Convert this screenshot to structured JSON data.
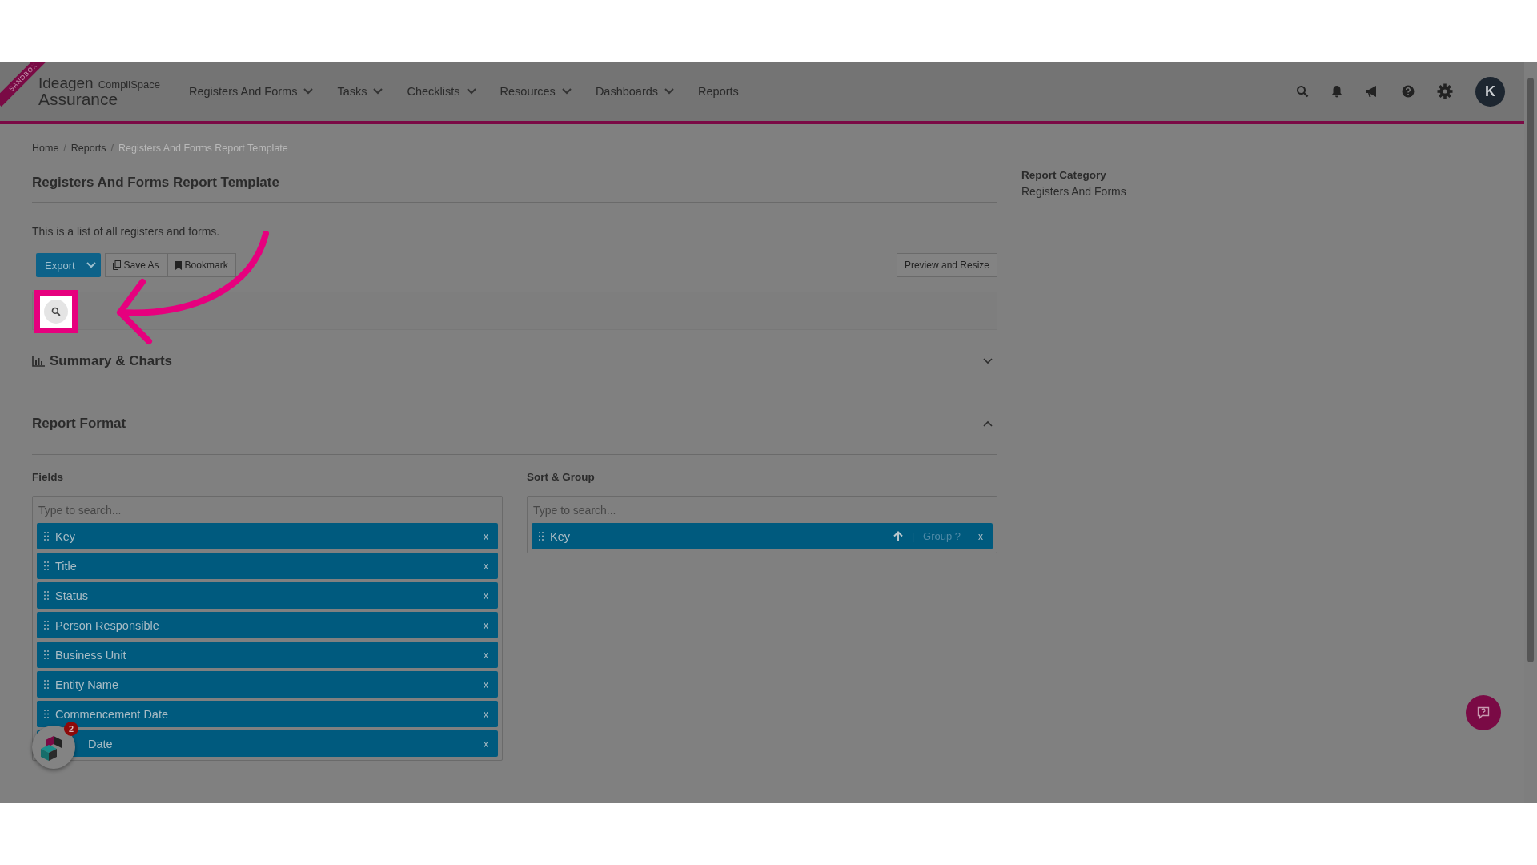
{
  "header": {
    "ribbon": "SANDBOX",
    "logo": {
      "brand": "Ideagen",
      "product": "CompliSpace",
      "subtitle": "Assurance"
    },
    "nav": [
      {
        "label": "Registers And Forms",
        "dropdown": true
      },
      {
        "label": "Tasks",
        "dropdown": true
      },
      {
        "label": "Checklists",
        "dropdown": true
      },
      {
        "label": "Resources",
        "dropdown": true
      },
      {
        "label": "Dashboards",
        "dropdown": true
      },
      {
        "label": "Reports",
        "dropdown": false
      }
    ],
    "avatar": "K"
  },
  "breadcrumb": {
    "separator": "/",
    "items": [
      {
        "label": "Home",
        "current": false
      },
      {
        "label": "Reports",
        "current": false
      },
      {
        "label": "Registers And Forms Report Template",
        "current": true
      }
    ]
  },
  "title": "Registers And Forms Report Template",
  "description": "This is a list of all registers and forms.",
  "toolbar": {
    "export": "Export",
    "save_as": "Save As",
    "bookmark": "Bookmark",
    "preview": "Preview and Resize"
  },
  "sections": [
    {
      "title": "Summary & Charts",
      "kind": "chart",
      "expanded": false
    },
    {
      "title": "Report Format",
      "kind": "plain",
      "expanded": true
    }
  ],
  "fields": {
    "label": "Fields",
    "placeholder": "Type to search...",
    "items": [
      {
        "label": "Key",
        "remove": "x",
        "obscured": false
      },
      {
        "label": "Title",
        "remove": "x",
        "obscured": false
      },
      {
        "label": "Status",
        "remove": "x",
        "obscured": false
      },
      {
        "label": "Person Responsible",
        "remove": "x",
        "obscured": false
      },
      {
        "label": "Business Unit",
        "remove": "x",
        "obscured": false
      },
      {
        "label": "Entity Name",
        "remove": "x",
        "obscured": false
      },
      {
        "label": "Commencement Date",
        "remove": "x",
        "obscured": false
      },
      {
        "label": "Date",
        "remove": "x",
        "obscured": true
      }
    ]
  },
  "sort_group": {
    "label": "Sort & Group",
    "placeholder": "Type to search...",
    "items": [
      {
        "label": "Key",
        "divider": "|",
        "group_label": "Group ?",
        "remove": "x"
      }
    ]
  },
  "side": {
    "label": "Report Category",
    "value": "Registers And Forms"
  },
  "app_badge": {
    "count": "2"
  }
}
